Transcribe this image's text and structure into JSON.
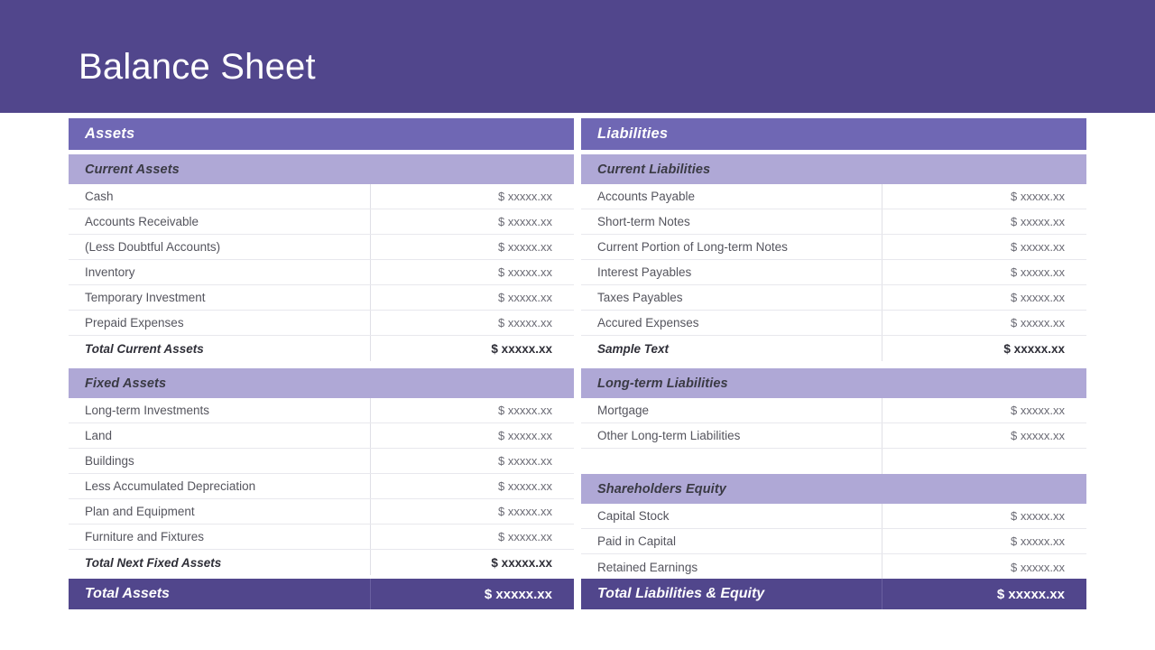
{
  "header": {
    "title": "Balance Sheet",
    "band_color": "#51468c"
  },
  "theme": {
    "major_bar_color": "#6f67b4",
    "minor_bar_color": "#afa8d6",
    "total_bar_color": "#51468c",
    "row_text_color": "#55555e",
    "amount_text_color": "#6a6a74"
  },
  "assets": {
    "heading": "Assets",
    "current": {
      "heading": "Current Assets",
      "rows": [
        {
          "label": "Cash",
          "amount": "$ xxxxx.xx"
        },
        {
          "label": "Accounts Receivable",
          "amount": "$ xxxxx.xx"
        },
        {
          "label": "(Less Doubtful Accounts)",
          "amount": "$ xxxxx.xx"
        },
        {
          "label": "Inventory",
          "amount": "$ xxxxx.xx"
        },
        {
          "label": "Temporary Investment",
          "amount": "$ xxxxx.xx"
        },
        {
          "label": "Prepaid Expenses",
          "amount": "$ xxxxx.xx"
        }
      ],
      "total": {
        "label": "Total Current Assets",
        "amount": "$ xxxxx.xx"
      }
    },
    "fixed": {
      "heading": "Fixed Assets",
      "rows": [
        {
          "label": "Long-term Investments",
          "amount": "$ xxxxx.xx"
        },
        {
          "label": "Land",
          "amount": "$ xxxxx.xx"
        },
        {
          "label": "Buildings",
          "amount": "$ xxxxx.xx"
        },
        {
          "label": "Less Accumulated Depreciation",
          "amount": "$ xxxxx.xx"
        },
        {
          "label": "Plan and Equipment",
          "amount": "$ xxxxx.xx"
        },
        {
          "label": "Furniture and Fixtures",
          "amount": "$ xxxxx.xx"
        }
      ],
      "total": {
        "label": "Total Next Fixed Assets",
        "amount": "$ xxxxx.xx"
      }
    },
    "grand_total": {
      "label": "Total Assets",
      "amount": "$ xxxxx.xx"
    }
  },
  "liabilities": {
    "heading": "Liabilities",
    "current": {
      "heading": "Current Liabilities",
      "rows": [
        {
          "label": "Accounts Payable",
          "amount": "$ xxxxx.xx"
        },
        {
          "label": "Short-term Notes",
          "amount": "$ xxxxx.xx"
        },
        {
          "label": "Current Portion of Long-term Notes",
          "amount": "$ xxxxx.xx"
        },
        {
          "label": "Interest Payables",
          "amount": "$ xxxxx.xx"
        },
        {
          "label": "Taxes Payables",
          "amount": "$ xxxxx.xx"
        },
        {
          "label": "Accured Expenses",
          "amount": "$ xxxxx.xx"
        }
      ],
      "total": {
        "label": "Sample Text",
        "amount": "$ xxxxx.xx"
      }
    },
    "longterm": {
      "heading": "Long-term Liabilities",
      "rows": [
        {
          "label": "Mortgage",
          "amount": "$ xxxxx.xx"
        },
        {
          "label": "Other Long-term Liabilities",
          "amount": "$ xxxxx.xx"
        },
        {
          "label": "",
          "amount": ""
        }
      ]
    },
    "equity": {
      "heading": "Shareholders Equity",
      "rows": [
        {
          "label": "Capital Stock",
          "amount": "$ xxxxx.xx"
        },
        {
          "label": "Paid in  Capital",
          "amount": "$ xxxxx.xx"
        },
        {
          "label": "Retained Earnings",
          "amount": "$ xxxxx.xx"
        }
      ]
    },
    "grand_total": {
      "label": "Total Liabilities & Equity",
      "amount": "$ xxxxx.xx"
    }
  }
}
